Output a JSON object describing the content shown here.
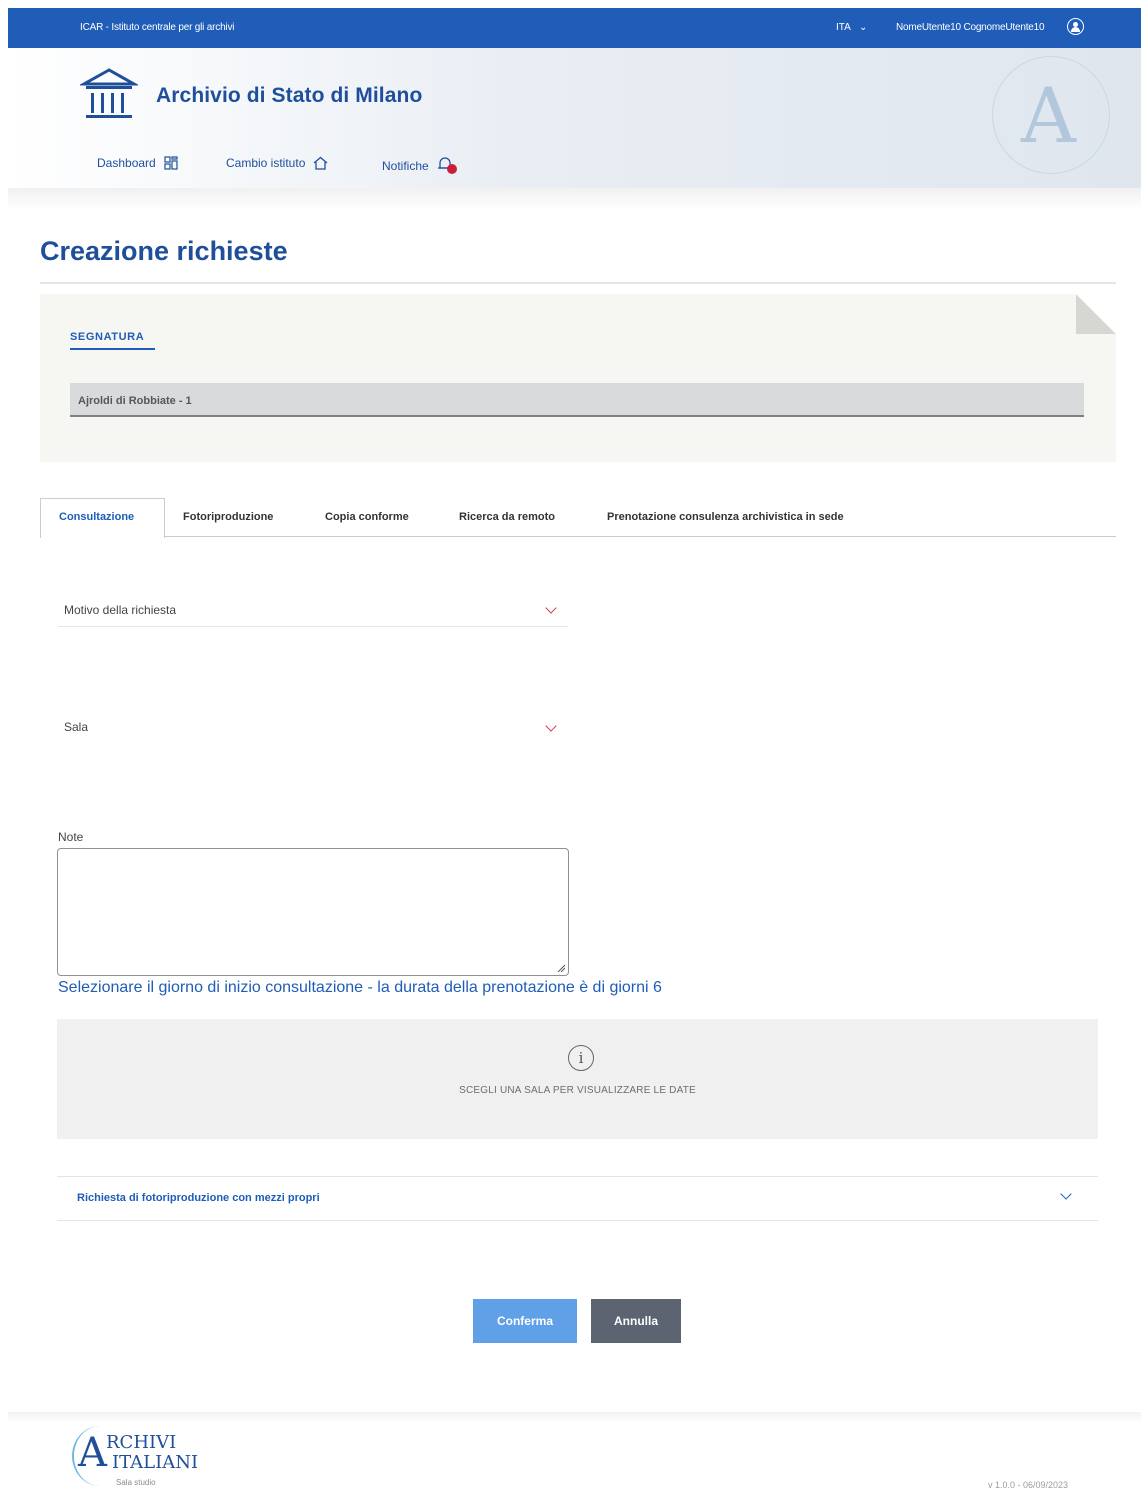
{
  "topbar": {
    "institute": "ICAR - Istituto centrale per gli archivi",
    "language": "ITA",
    "user": "NomeUtente10 CognomeUtente10"
  },
  "header": {
    "title": "Archivio di Stato di Milano",
    "nav": [
      {
        "label": "Dashboard",
        "icon": "grid-icon"
      },
      {
        "label": "Cambio istituto",
        "icon": "home-icon"
      },
      {
        "label": "Notifiche",
        "icon": "bell-icon"
      }
    ]
  },
  "page": {
    "title": "Creazione richieste"
  },
  "segnatura": {
    "label": "SEGNATURA",
    "value": "Ajroldi di Robbiate - 1"
  },
  "tabs": [
    {
      "label": "Consultazione",
      "active": true
    },
    {
      "label": "Fotoriproduzione",
      "active": false
    },
    {
      "label": "Copia conforme",
      "active": false
    },
    {
      "label": "Ricerca da remoto",
      "active": false
    },
    {
      "label": "Prenotazione consulenza archivistica in sede",
      "active": false
    }
  ],
  "form": {
    "motivo_label": "Motivo della richiesta",
    "sala_label": "Sala",
    "note_label": "Note",
    "note_value": "",
    "select_day_text": "Selezionare il giorno di inizio consultazione - la durata della prenotazione è di giorni 6",
    "info_text": "SCEGLI UNA SALA PER VISUALIZZARE LE DATE",
    "accordion_title": "Richiesta di fotoriproduzione con mezzi propri"
  },
  "buttons": {
    "confirm": "Conferma",
    "cancel": "Annulla"
  },
  "footer": {
    "logo_line1": "RCHIVI",
    "logo_line2": "ITALIANI",
    "logo_big_letter": "A",
    "logo_sub": "Sala studio",
    "version": "v 1.0.0 - 06/09/2023"
  },
  "colors": {
    "primary": "#1f5db8",
    "title": "#1f4f9a",
    "chevron": "#d43a57",
    "confirm_button": "#5fa0e6",
    "cancel_button": "#5b6470"
  }
}
